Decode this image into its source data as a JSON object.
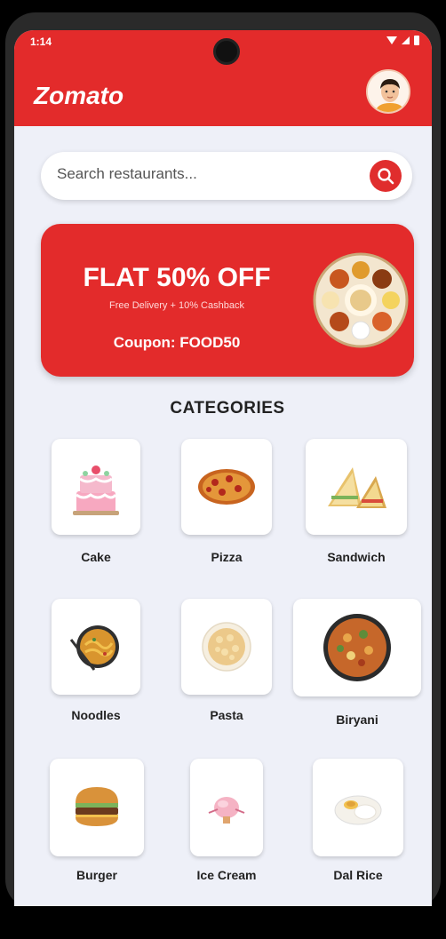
{
  "status": {
    "time": "1:14"
  },
  "app": {
    "title": "Zomato"
  },
  "search": {
    "placeholder": "Search restaurants..."
  },
  "banner": {
    "title": "FLAT 50% OFF",
    "subtitle": "Free Delivery + 10% Cashback",
    "coupon": "Coupon: FOOD50"
  },
  "categories": {
    "title": "CATEGORIES",
    "items": [
      {
        "label": "Cake",
        "icon": "cake-icon"
      },
      {
        "label": "Pizza",
        "icon": "pizza-icon"
      },
      {
        "label": "Sandwich",
        "icon": "sandwich-icon"
      },
      {
        "label": "Noodles",
        "icon": "noodles-icon"
      },
      {
        "label": "Pasta",
        "icon": "pasta-icon"
      },
      {
        "label": "Biryani",
        "icon": "biryani-icon"
      },
      {
        "label": "Burger",
        "icon": "burger-icon"
      },
      {
        "label": "Ice Cream",
        "icon": "ice-cream-icon"
      },
      {
        "label": "Dal Rice",
        "icon": "dal-rice-icon"
      }
    ]
  },
  "colors": {
    "primary": "#e32b2b",
    "background": "#eef0f8"
  }
}
